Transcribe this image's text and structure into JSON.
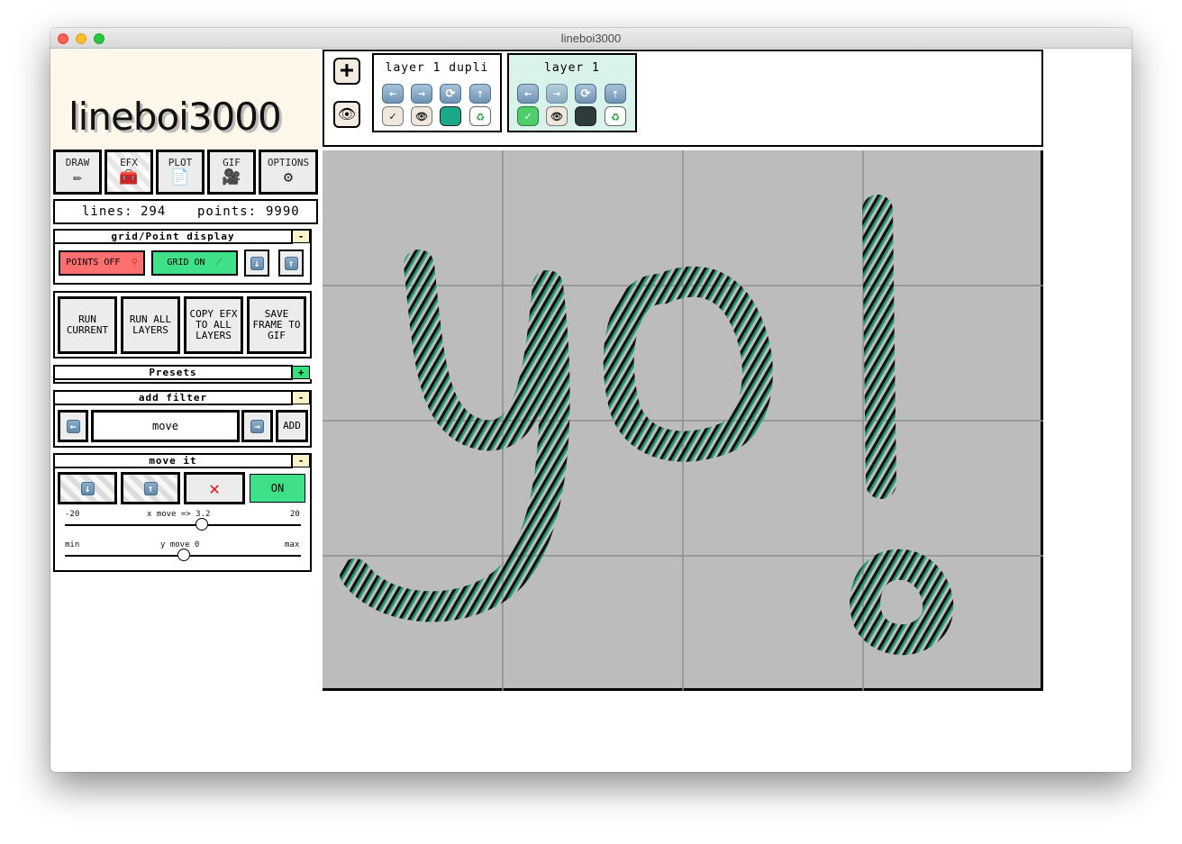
{
  "window": {
    "title": "lineboi3000"
  },
  "logo": {
    "text": "lineboi3000"
  },
  "tabs": [
    {
      "label": "DRAW",
      "icon": "pencil-icon",
      "glyph": "✏"
    },
    {
      "label": "EFX",
      "icon": "toolbox-icon",
      "glyph": "🧰"
    },
    {
      "label": "PLOT",
      "icon": "paper-icon",
      "glyph": "📄"
    },
    {
      "label": "GIF",
      "icon": "movie-camera-icon",
      "glyph": "🎥"
    },
    {
      "label": "OPTIONS",
      "icon": "gear-icon",
      "glyph": "⚙"
    }
  ],
  "stats": {
    "lines_label": "lines:",
    "lines_value": "294",
    "points_label": "points:",
    "points_value": "9990"
  },
  "grid_point_section": {
    "title": "grid/Point display",
    "collapse_label": "-",
    "points_button": "POINTS OFF",
    "grid_button": "GRID ON"
  },
  "actions": {
    "run_current": "RUN CURRENT",
    "run_all_layers": "RUN ALL LAYERS",
    "copy_efx": "COPY EFX TO ALL LAYERS",
    "save_frame": "SAVE FRAME TO GIF"
  },
  "presets": {
    "title": "Presets",
    "expand_label": "+"
  },
  "add_filter": {
    "title": "add filter",
    "collapse_label": "-",
    "selected": "move",
    "add_button": "ADD"
  },
  "move_it": {
    "title": "move it",
    "collapse_label": "-",
    "remove_glyph": "✕",
    "on_button": "ON",
    "x_min": "-20",
    "x_max": "20",
    "x_label": "x move => 3.2",
    "x_value": 3.2,
    "y_min": "min",
    "y_max": "max",
    "y_label": "y move 0",
    "y_value": 0
  },
  "layers_bar": {
    "add_layer_glyph": "+",
    "layers": [
      {
        "name": "layer 1 dupli",
        "active": false
      },
      {
        "name": "layer 1",
        "active": true
      }
    ]
  },
  "colors": {
    "accent_green": "#3fe08a",
    "alert_red": "#ff6f6f",
    "stroke_teal": "#1f9874",
    "active_layer_bg": "#d9f3ea",
    "layer_swatch_1": "#1ba98a",
    "layer_swatch_2": "#2d3b3a"
  }
}
